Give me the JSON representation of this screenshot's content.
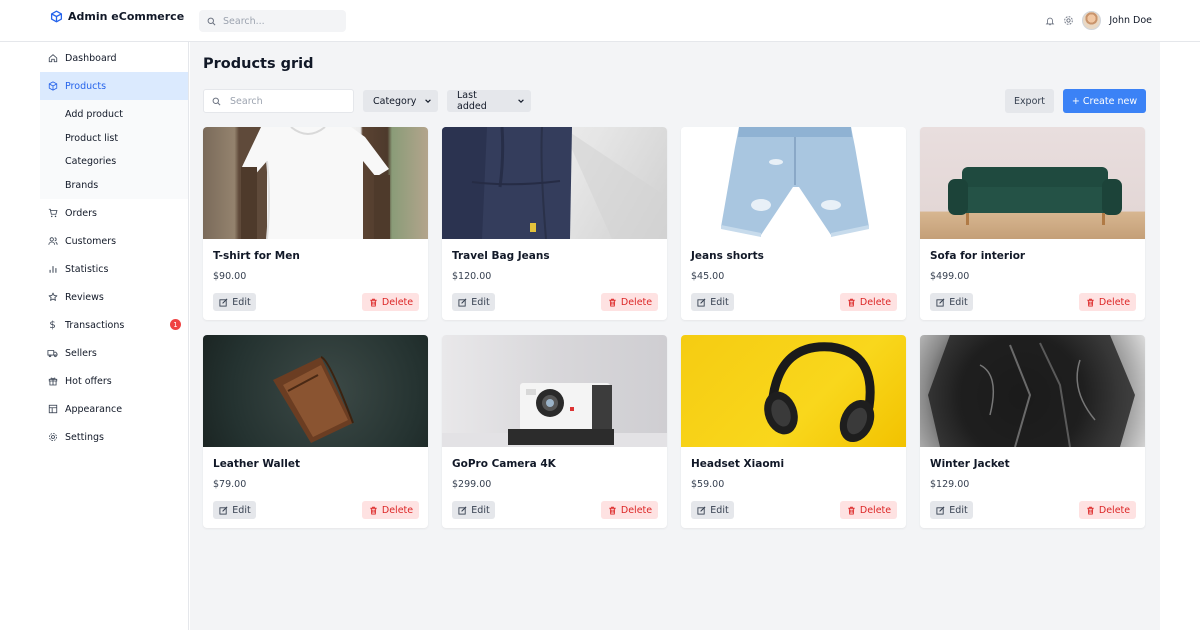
{
  "app": {
    "title": "Admin eCommerce"
  },
  "topbar": {
    "search_placeholder": "Search...",
    "user_name": "John Doe"
  },
  "sidebar": {
    "items": [
      {
        "label": "Dashboard",
        "icon": "home-icon"
      },
      {
        "label": "Products",
        "icon": "cube-icon",
        "active": true,
        "children": [
          {
            "label": "Add product"
          },
          {
            "label": "Product list"
          },
          {
            "label": "Categories"
          },
          {
            "label": "Brands"
          }
        ]
      },
      {
        "label": "Orders",
        "icon": "cart-icon"
      },
      {
        "label": "Customers",
        "icon": "users-icon"
      },
      {
        "label": "Statistics",
        "icon": "bar-chart-icon"
      },
      {
        "label": "Reviews",
        "icon": "star-icon"
      },
      {
        "label": "Transactions",
        "icon": "dollar-icon",
        "badge": "1"
      },
      {
        "label": "Sellers",
        "icon": "truck-icon"
      },
      {
        "label": "Hot offers",
        "icon": "gift-icon"
      },
      {
        "label": "Appearance",
        "icon": "layout-icon"
      },
      {
        "label": "Settings",
        "icon": "gear-icon"
      }
    ]
  },
  "main": {
    "title": "Products grid",
    "search_placeholder": "Search",
    "category_select": "Category",
    "sort_select": "Last added",
    "export_label": "Export",
    "create_label": "+ Create new",
    "edit_label": "Edit",
    "delete_label": "Delete",
    "products": [
      {
        "name": "T-shirt for Men",
        "price": "$90.00",
        "image": "tshirt"
      },
      {
        "name": "Travel Bag Jeans",
        "price": "$120.00",
        "image": "bag"
      },
      {
        "name": "Jeans shorts",
        "price": "$45.00",
        "image": "jeans"
      },
      {
        "name": "Sofa for interior",
        "price": "$499.00",
        "image": "sofa"
      },
      {
        "name": "Leather Wallet",
        "price": "$79.00",
        "image": "wallet"
      },
      {
        "name": "GoPro Camera 4K",
        "price": "$299.00",
        "image": "camera"
      },
      {
        "name": "Headset Xiaomi",
        "price": "$59.00",
        "image": "headset"
      },
      {
        "name": "Winter Jacket",
        "price": "$129.00",
        "image": "jacket"
      }
    ]
  },
  "colors": {
    "accent": "#3b82f6",
    "active_bg": "#dbeafe",
    "danger": "#dc2626",
    "danger_bg": "#fee2e2",
    "main_bg": "#f3f4f6"
  }
}
